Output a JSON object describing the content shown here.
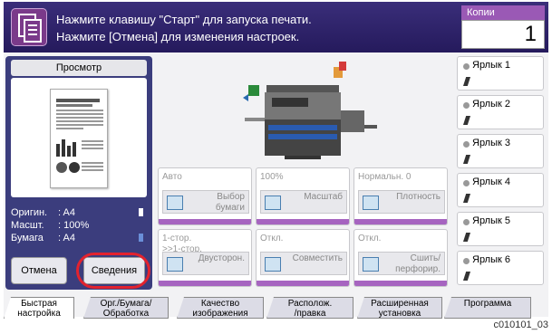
{
  "message": {
    "line1": "Нажмите клавишу \"Старт\" для запуска печати.",
    "line2": "Нажмите [Отмена] для изменения настроек."
  },
  "copies": {
    "label": "Копии",
    "value": "1"
  },
  "left_panel": {
    "preview_tab": "Просмотр",
    "info": [
      {
        "label": "Оригин.",
        "value": ": A4"
      },
      {
        "label": "Масшт.",
        "value": ": 100%"
      },
      {
        "label": "Бумага",
        "value": ": A4"
      }
    ],
    "cancel_label": "Отмена",
    "details_label": "Сведения"
  },
  "grid": [
    {
      "value": "Авто",
      "label": "Выбор\nбумаги"
    },
    {
      "value": "100%",
      "label": "Масштаб"
    },
    {
      "value": "Нормальн. 0",
      "label": "Плотность"
    },
    {
      "value": "1-стор.\n>>1-стор.",
      "label": "Двусторон."
    },
    {
      "value": "Откл.",
      "label": "Совместить"
    },
    {
      "value": "Откл.",
      "label": "Сшить/\nперфорир."
    }
  ],
  "shortcuts": [
    "Ярлык 1",
    "Ярлык 2",
    "Ярлык 3",
    "Ярлык 4",
    "Ярлык 5",
    "Ярлык 6"
  ],
  "tabs": [
    {
      "label": "Быстрая\nнастройка"
    },
    {
      "label": "Орг./Бумага/\nОбработка"
    },
    {
      "label": "Качество\nизображения"
    },
    {
      "label": "Располож.\n/правка"
    },
    {
      "label": "Расширенная\nустановка"
    },
    {
      "label": "Программа"
    }
  ],
  "figure_code": "c010101_03",
  "colors": {
    "header": "#2d2268",
    "accent": "#a664c0",
    "highlight": "#e3222e"
  }
}
